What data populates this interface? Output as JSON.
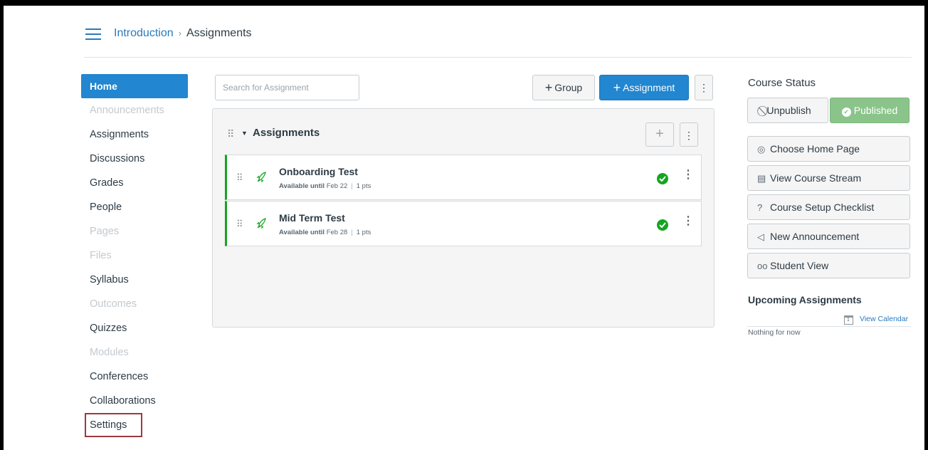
{
  "breadcrumb": {
    "course": "Introduction",
    "separator": "›",
    "current": "Assignments"
  },
  "nav": {
    "items": [
      {
        "label": "Home",
        "state": "active"
      },
      {
        "label": "Announcements",
        "state": "disabled"
      },
      {
        "label": "Assignments",
        "state": "enabled"
      },
      {
        "label": "Discussions",
        "state": "enabled"
      },
      {
        "label": "Grades",
        "state": "enabled"
      },
      {
        "label": "People",
        "state": "enabled"
      },
      {
        "label": "Pages",
        "state": "disabled"
      },
      {
        "label": "Files",
        "state": "disabled"
      },
      {
        "label": "Syllabus",
        "state": "enabled"
      },
      {
        "label": "Outcomes",
        "state": "disabled"
      },
      {
        "label": "Quizzes",
        "state": "enabled"
      },
      {
        "label": "Modules",
        "state": "disabled"
      },
      {
        "label": "Conferences",
        "state": "enabled"
      },
      {
        "label": "Collaborations",
        "state": "enabled"
      },
      {
        "label": "Settings",
        "state": "highlighted"
      }
    ]
  },
  "toolbar": {
    "search_placeholder": "Search for Assignment",
    "group_label": "Group",
    "assignment_label": "Assignment",
    "plus": "+",
    "kebab": "⋮"
  },
  "assignment_group": {
    "title": "Assignments",
    "add": "+",
    "kebab": "⋮",
    "assignments": [
      {
        "title": "Onboarding Test",
        "available_label": "Available until",
        "date": "Feb 22",
        "points": "1 pts",
        "status": "published"
      },
      {
        "title": "Mid Term Test",
        "available_label": "Available until",
        "date": "Feb 28",
        "points": "1 pts",
        "status": "published"
      }
    ]
  },
  "sidebar": {
    "course_status_heading": "Course Status",
    "unpublish_label": "Unpublish",
    "published_label": "Published",
    "buttons": {
      "choose_home": "Choose Home Page",
      "view_stream": "View Course Stream",
      "setup_checklist": "Course Setup Checklist",
      "new_announcement": "New Announcement",
      "student_view": "Student View"
    },
    "upcoming_heading": "Upcoming Assignments",
    "calendar_icon_text": "1",
    "view_calendar": "View Calendar",
    "nothing": "Nothing for now"
  },
  "colors": {
    "brand_blue": "#2286d0",
    "link_blue": "#2b7abc",
    "published_green": "#14a51f",
    "published_button": "#8bc48a",
    "highlight_border": "#9a3a3f"
  },
  "icons": {
    "menu": "hamburger-menu-icon",
    "drag": "drag-handle-icon",
    "assignment": "assignment-rocket-icon",
    "published": "check-circle-icon",
    "unpublish": "no-entry-icon",
    "home_page": "target-icon",
    "stream": "stream-icon",
    "checklist": "question-circle-icon",
    "announcement": "megaphone-icon",
    "student_view": "glasses-icon",
    "calendar": "calendar-icon"
  }
}
